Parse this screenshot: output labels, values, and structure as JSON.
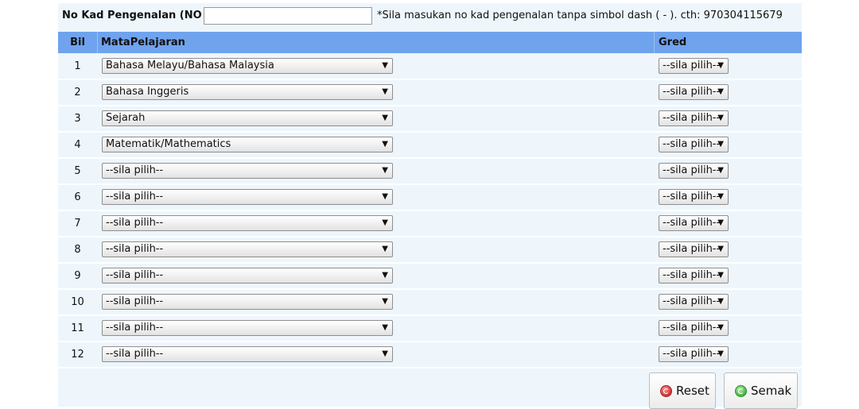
{
  "form": {
    "kp_label": "No Kad Pengenalan (NO KP) :",
    "kp_value": "",
    "kp_note": "*Sila masukan no kad pengenalan tanpa simbol dash ( - ). cth: 970304115679"
  },
  "table": {
    "headers": {
      "bil": "Bil",
      "subject": "MataPelajaran",
      "grade": "Gred"
    },
    "rows": [
      {
        "bil": "1",
        "subject": "Bahasa Melayu/Bahasa Malaysia",
        "grade": "--sila pilih--"
      },
      {
        "bil": "2",
        "subject": "Bahasa Inggeris",
        "grade": "--sila pilih--"
      },
      {
        "bil": "3",
        "subject": "Sejarah",
        "grade": "--sila pilih--"
      },
      {
        "bil": "4",
        "subject": "Matematik/Mathematics",
        "grade": "--sila pilih--"
      },
      {
        "bil": "5",
        "subject": "--sila pilih--",
        "grade": "--sila pilih--"
      },
      {
        "bil": "6",
        "subject": "--sila pilih--",
        "grade": "--sila pilih--"
      },
      {
        "bil": "7",
        "subject": "--sila pilih--",
        "grade": "--sila pilih--"
      },
      {
        "bil": "8",
        "subject": "--sila pilih--",
        "grade": "--sila pilih--"
      },
      {
        "bil": "9",
        "subject": "--sila pilih--",
        "grade": "--sila pilih--"
      },
      {
        "bil": "10",
        "subject": "--sila pilih--",
        "grade": "--sila pilih--"
      },
      {
        "bil": "11",
        "subject": "--sila pilih--",
        "grade": "--sila pilih--"
      },
      {
        "bil": "12",
        "subject": "--sila pilih--",
        "grade": "--sila pilih--"
      }
    ]
  },
  "buttons": {
    "reset": "Reset",
    "semak": "Semak"
  },
  "icons": {
    "dropdown": "chevron-down-icon",
    "reset": "reset-icon",
    "semak": "check-icon"
  },
  "colors": {
    "header_bg": "#6fa3ee",
    "panel_bg": "#eef6fc"
  }
}
